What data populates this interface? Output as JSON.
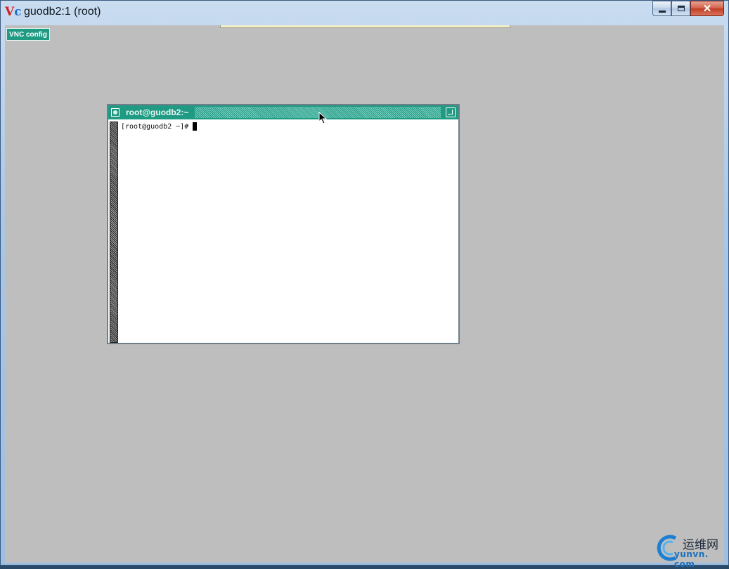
{
  "window": {
    "title": "guodb2:1 (root)",
    "icon": "vnc-viewer-icon",
    "icon_letters": [
      "V",
      "c"
    ],
    "close_glyph": "✕"
  },
  "vnc": {
    "config_button_label": "VNC config"
  },
  "xterm": {
    "title": "root@guodb2:~",
    "prompt": "[root@guodb2 ~]#"
  },
  "watermark": {
    "chinese": "运维网",
    "latin": "yunvn. com"
  },
  "colors": {
    "desktop_bg": "#bebebe",
    "twm_accent": "#1f9a83",
    "terminal_bg": "#ffffff"
  }
}
